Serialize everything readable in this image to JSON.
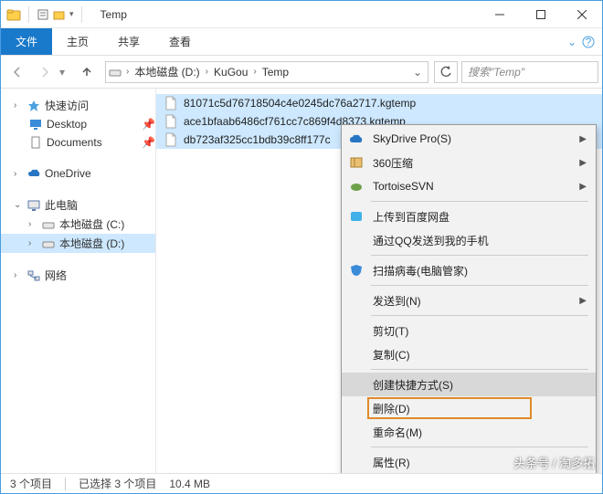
{
  "titlebar": {
    "title": "Temp"
  },
  "ribbon": {
    "file": "文件",
    "home": "主页",
    "share": "共享",
    "view": "查看"
  },
  "breadcrumb": {
    "items": [
      "本地磁盘 (D:)",
      "KuGou",
      "Temp"
    ]
  },
  "search": {
    "placeholder": "搜索\"Temp\""
  },
  "sidebar": {
    "quick": {
      "label": "快速访问",
      "children": [
        {
          "label": "Desktop",
          "pinned": true
        },
        {
          "label": "Documents",
          "pinned": true
        }
      ]
    },
    "onedrive": {
      "label": "OneDrive"
    },
    "thispc": {
      "label": "此电脑",
      "children": [
        {
          "label": "本地磁盘 (C:)"
        },
        {
          "label": "本地磁盘 (D:)",
          "selected": true
        }
      ]
    },
    "network": {
      "label": "网络"
    }
  },
  "files": [
    {
      "name": "81071c5d76718504c4e0245dc76a2717.kgtemp",
      "selected": true
    },
    {
      "name": "ace1bfaab6486cf761cc7c869f4d8373.kgtemp",
      "selected": true
    },
    {
      "name": "db723af325cc1bdb39c8ff177c",
      "selected": true,
      "truncated": true
    }
  ],
  "context_menu": {
    "items": [
      {
        "label": "SkyDrive Pro(S)",
        "icon": "cloud",
        "submenu": true
      },
      {
        "label": "360压缩",
        "icon": "zip",
        "submenu": true
      },
      {
        "label": "TortoiseSVN",
        "icon": "svn",
        "submenu": true
      },
      {
        "sep": true
      },
      {
        "label": "上传到百度网盘",
        "icon": "baidu"
      },
      {
        "label": "通过QQ发送到我的手机"
      },
      {
        "sep": true
      },
      {
        "label": "扫描病毒(电脑管家)",
        "icon": "shield"
      },
      {
        "sep": true
      },
      {
        "label": "发送到(N)",
        "submenu": true
      },
      {
        "sep": true
      },
      {
        "label": "剪切(T)"
      },
      {
        "label": "复制(C)"
      },
      {
        "sep": true
      },
      {
        "label": "创建快捷方式(S)",
        "hover": true
      },
      {
        "label": "删除(D)",
        "highlight": true
      },
      {
        "label": "重命名(M)"
      },
      {
        "sep": true
      },
      {
        "label": "属性(R)"
      }
    ]
  },
  "statusbar": {
    "count": "3 个项目",
    "selection": "已选择 3 个项目",
    "size": "10.4 MB"
  },
  "watermark": {
    "text": "头条号 / 淘多拓"
  }
}
